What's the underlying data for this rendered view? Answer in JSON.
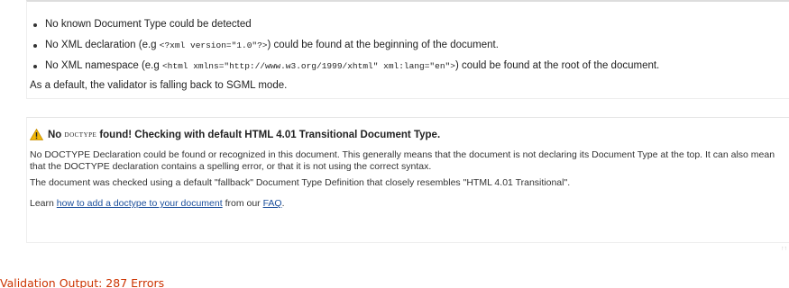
{
  "reasons": [
    {
      "text": "No known Document Type could be detected"
    },
    {
      "text_before": "No XML declaration (e.g ",
      "code": "<?xml version=\"1.0\"?>",
      "text_after": ") could be found at the beginning of the document."
    },
    {
      "text_before": "No XML namespace (e.g ",
      "code": "<html xmlns=\"http://www.w3.org/1999/xhtml\" xml:lang=\"en\">",
      "text_after": ") could be found at the root of the document."
    }
  ],
  "fallback_note": "As a default, the validator is falling back to SGML mode.",
  "warning": {
    "icon": "warning-icon",
    "doctype_word": "doctype",
    "title_rest": "found! Checking with default HTML 4.01 Transitional Document Type.",
    "paragraph1": "No DOCTYPE Declaration could be found or recognized in this document. This generally means that the document is not declaring its Document Type at the top. It can also mean that the DOCTYPE declaration contains a spelling error, or that it is not using the correct syntax.",
    "paragraph2": "The document was checked using a default \"fallback\" Document Type Definition that closely resembles \"HTML 4.01 Transitional\".",
    "learn_prefix": "Learn ",
    "learn_link": "how to add a doctype to your document",
    "learn_middle": " from our ",
    "faq_link": "FAQ",
    "learn_suffix": "."
  },
  "output_heading": "Validation Output: 287 Errors",
  "colors": {
    "link": "#1a4e9b",
    "heading_red": "#cc3300",
    "warning_yellow": "#f2b705"
  }
}
